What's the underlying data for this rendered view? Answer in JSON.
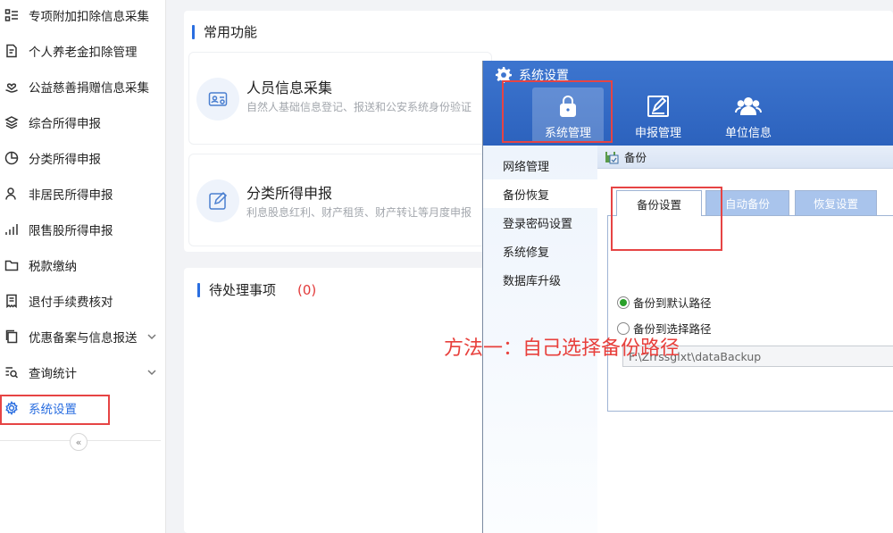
{
  "sidebar": {
    "items": [
      {
        "label": "专项附加扣除信息采集",
        "icon": "list-icon"
      },
      {
        "label": "个人养老金扣除管理",
        "icon": "document-edit-icon"
      },
      {
        "label": "公益慈善捐赠信息采集",
        "icon": "heart-hand-icon"
      },
      {
        "label": "综合所得申报",
        "icon": "layers-icon"
      },
      {
        "label": "分类所得申报",
        "icon": "pie-chart-icon"
      },
      {
        "label": "非居民所得申报",
        "icon": "person-icon"
      },
      {
        "label": "限售股所得申报",
        "icon": "bar-chart-icon"
      },
      {
        "label": "税款缴纳",
        "icon": "folder-icon"
      },
      {
        "label": "退付手续费核对",
        "icon": "receipt-icon"
      },
      {
        "label": "优惠备案与信息报送",
        "icon": "copy-icon",
        "expandable": true
      },
      {
        "label": "查询统计",
        "icon": "search-list-icon",
        "expandable": true
      },
      {
        "label": "系统设置",
        "icon": "gear-icon",
        "active": true
      }
    ],
    "collapse_symbol": "«"
  },
  "main": {
    "common_title": "常用功能",
    "functions": [
      {
        "title": "人员信息采集",
        "desc": "自然人基础信息登记、报送和公安系统身份验证"
      },
      {
        "title": "分类所得申报",
        "desc": "利息股息红利、财产租赁、财产转让等月度申报"
      }
    ],
    "pending_title": "待处理事项",
    "pending_count": "(0)"
  },
  "dialog": {
    "title": "系统设置",
    "toolbar": [
      {
        "label": "系统管理",
        "icon": "lock-icon",
        "selected": true
      },
      {
        "label": "申报管理",
        "icon": "edit-form-icon"
      },
      {
        "label": "单位信息",
        "icon": "users-icon"
      }
    ],
    "menu": [
      "网络管理",
      "备份恢复",
      "登录密码设置",
      "系统修复",
      "数据库升级"
    ],
    "selected_menu": "备份恢复",
    "section_title": "备份",
    "tabs": [
      "备份设置",
      "自动备份",
      "恢复设置"
    ],
    "active_tab": "备份设置",
    "radios": [
      {
        "label": "备份到默认路径",
        "checked": true
      },
      {
        "label": "备份到选择路径",
        "checked": false
      }
    ],
    "path_value": "F:\\Zrrssglxt\\dataBackup"
  },
  "annotation": "方法一：自己选择备份路径",
  "colors": {
    "accent": "#2a6ee0",
    "highlight_red": "#e64444",
    "dialog_header": "#3d75cf"
  }
}
